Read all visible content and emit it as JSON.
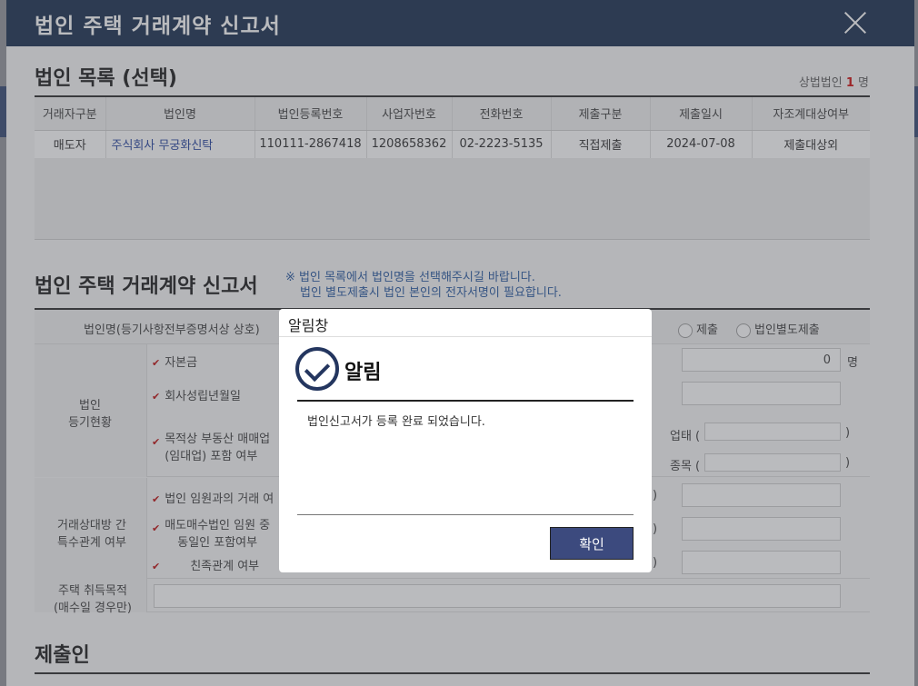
{
  "window": {
    "title": "법인 주택 거래계약 신고서"
  },
  "corp_list": {
    "section_title": "법인 목록 (선택)",
    "count_label": "상법법인",
    "count_value": "1",
    "count_unit": "명",
    "columns": [
      "거래자구분",
      "법인명",
      "법인등록번호",
      "사업자번호",
      "전화번호",
      "제출구분",
      "제출일시",
      "자조계대상여부"
    ],
    "rows": [
      [
        "매도자",
        "주식회사 무궁화신탁",
        "110111-2867418",
        "1208658362",
        "02-2223-5135",
        "직접제출",
        "2024-07-08",
        "제출대상외"
      ]
    ]
  },
  "report": {
    "section_title": "법인 주택 거래계약 신고서",
    "note_line1": "※ 법인 목록에서 법인명을 선택해주시길 바랍니다.",
    "note_line2": "법인 별도제출시 법인 본인의 전자서명이 필요합니다.",
    "corp_name_label": "법인명(등기사항전부증명서상 상호)",
    "radio_submit": "제출",
    "radio_separate": "법인별도제출",
    "reg_status_label1": "법인",
    "reg_status_label2": "등기현황",
    "capital_label": "자본금",
    "founded_label": "회사성립년월일",
    "purpose_label1": "목적상 부동산 매매업",
    "purpose_label2": "(임대업) 포함 여부",
    "employee_value": "0",
    "employee_unit": "명",
    "biz_type_label": "업태 (",
    "biz_item_label": "종목 (",
    "paren_close": ")",
    "relation_label1": "거래상대방 간",
    "relation_label2": "특수관계 여부",
    "exec_label": "법인 임원과의 거래 여",
    "same_person_label1": "매도매수법인 임원 중",
    "same_person_label2": "동일인 포함여부",
    "family_label": "친족관계 여부",
    "purpose_acq_label1": "주택 취득목적",
    "purpose_acq_label2": "(매수일 경우만)"
  },
  "submitter": {
    "section_title": "제출인"
  },
  "dialog": {
    "header": "알림창",
    "title": "알림",
    "message": "법인신고서가 등록 완료 되었습니다.",
    "ok_label": "확인"
  }
}
